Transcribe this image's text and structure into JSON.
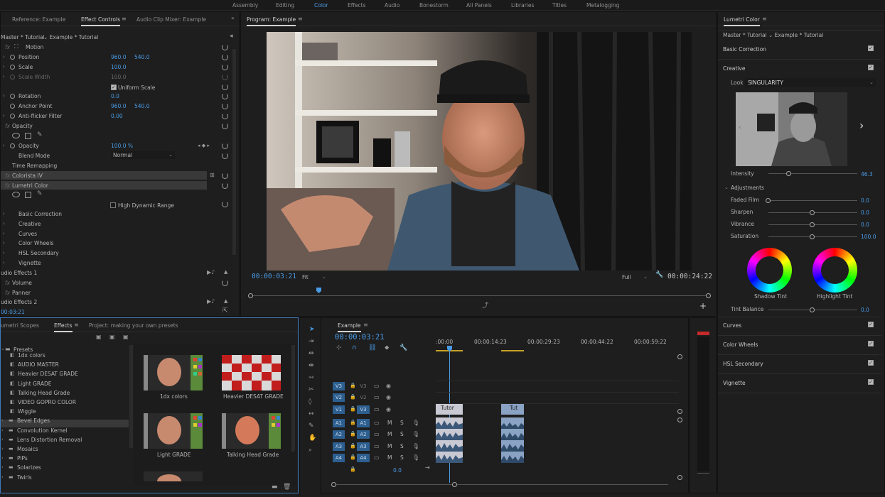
{
  "workspaces": [
    "Assembly",
    "Editing",
    "Color",
    "Effects",
    "Audio",
    "Bonestorm",
    "All Panels",
    "Libraries",
    "Titles",
    "Metalogging"
  ],
  "active_workspace": "Color",
  "colors": {
    "accent": "#4a9be6",
    "bg": "#1e1e1e",
    "selected_row": "#393939",
    "track_active": "#2d5f90",
    "playhead": "#4a9be6"
  },
  "effect_controls": {
    "tabs": [
      "Reference: Example",
      "Effect Controls",
      "Audio Clip Mixer: Example"
    ],
    "source": "Master * Tutorial",
    "sequence": "Example * Tutorial",
    "motion": "Motion",
    "position_label": "Position",
    "position_x": "960.0",
    "position_y": "540.0",
    "scale_label": "Scale",
    "scale": "100.0",
    "scale_width_label": "Scale Width",
    "scale_width": "100.0",
    "uniform_scale": "Uniform Scale",
    "rotation_label": "Rotation",
    "rotation": "0.0",
    "anchor_label": "Anchor Point",
    "anchor_x": "960.0",
    "anchor_y": "540.0",
    "antiflicker_label": "Anti-flicker Filter",
    "antiflicker": "0.00",
    "opacity_section": "Opacity",
    "opacity_label": "Opacity",
    "opacity": "100.0 %",
    "blend_label": "Blend Mode",
    "blend": "Normal",
    "time_remap": "Time Remapping",
    "colorista": "Colorista IV",
    "lumetri": "Lumetri Color",
    "hdr": "High Dynamic Range",
    "sub_items": [
      "Basic Correction",
      "Creative",
      "Curves",
      "Color Wheels",
      "HSL Secondary",
      "Vignette"
    ],
    "audio1": "udio Effects 1",
    "volume": "Volume",
    "panner": "Panner",
    "audio2": "udio Effects 2",
    "timecode": "00:03:21"
  },
  "program": {
    "title": "Program: Example",
    "timecode": "00:00:03:21",
    "fit": "Fit",
    "full": "Full",
    "duration": "00:00:24:22"
  },
  "effects_panel": {
    "tabs": [
      "umetri Scopes",
      "Effects",
      "Project: making your own presets"
    ],
    "presets_label": "Presets",
    "tree": [
      "1dx colors",
      "AUDIO MASTER",
      "Heavier DESAT GRADE",
      "Light GRADE",
      "Talking Head Grade",
      "VIDEO GOPRO COLOR",
      "Wiggle"
    ],
    "folders": [
      "Bevel Edges",
      "Convolution Kernel",
      "Lens Distortion Removal",
      "Mosaics",
      "PiPs",
      "Solarizes",
      "Twirls"
    ],
    "selected": "Talking Head Grade",
    "thumbs": [
      "1dx colors",
      "Heavier DESAT GRADE",
      "Light GRADE",
      "Talking Head Grade"
    ]
  },
  "timeline": {
    "title": "Example",
    "timecode": "00:00:03:21",
    "ruler": [
      ":00:00",
      "00:00:14:23",
      "00:00:29:23",
      "00:00:44:22",
      "00:00:59:22"
    ],
    "video_tracks": [
      {
        "src": "V3",
        "dst": "V3"
      },
      {
        "src": "V2",
        "dst": "V2"
      },
      {
        "src": "V1",
        "dst": "V3"
      }
    ],
    "audio_tracks": [
      {
        "src": "A1",
        "dst": "A1"
      },
      {
        "src": "A2",
        "dst": "A2"
      },
      {
        "src": "A3",
        "dst": "A3"
      },
      {
        "src": "A4",
        "dst": "A4"
      }
    ],
    "mute": "M",
    "solo": "S",
    "clip1": "Tutor",
    "clip2": "Tut",
    "mix": "0.0"
  },
  "lumetri": {
    "title": "Lumetri Color",
    "source": "Master * Tutorial",
    "sequence": "Example * Tutorial",
    "basic": "Basic Correction",
    "creative": "Creative",
    "look_label": "Look",
    "look": "SINGULARITY",
    "intensity_label": "Intensity",
    "intensity": "46.3",
    "adjustments": "Adjustments",
    "faded_label": "Faded Film",
    "faded": "0.0",
    "sharpen_label": "Sharpen",
    "sharpen": "0.0",
    "vibrance_label": "Vibrance",
    "vibrance": "0.0",
    "saturation_label": "Saturation",
    "saturation": "100.0",
    "shadow_tint": "Shadow Tint",
    "highlight_tint": "Highlight Tint",
    "tint_balance_label": "Tint Balance",
    "tint_balance": "0.0",
    "sections": [
      "Curves",
      "Color Wheels",
      "HSL Secondary",
      "Vignette"
    ]
  }
}
